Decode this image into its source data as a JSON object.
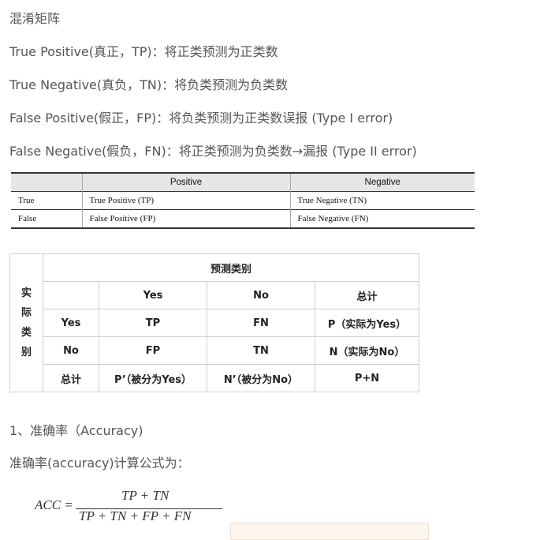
{
  "doc": {
    "heading": "混淆矩阵",
    "tp_def": "True Positive(真正，TP)：将正类预测为正类数",
    "tn_def": "True Negative(真负，TN)：将负类预测为负类数",
    "fp_def": "False Positive(假正，FP)：将负类预测为正类数误报 (Type I error)",
    "fn_def": "False Negative(假负，FN)：将正类预测为负类数→漏报 (Type II error)",
    "section1": "1、准确率（Accuracy)",
    "formula_intro": "准确率(accuracy)计算公式为："
  },
  "table1": {
    "headers": [
      "",
      "Positive",
      "Negative"
    ],
    "rows": [
      [
        "True",
        "True Positive (TP)",
        "True Negative (TN)"
      ],
      [
        "False",
        "False Positive (FP)",
        "False Negative (FN)"
      ]
    ]
  },
  "table2": {
    "predicted_header": "预测类别",
    "actual_chars": [
      "实",
      "际",
      "类",
      "别"
    ],
    "col_headers": [
      "Yes",
      "No",
      "总计"
    ],
    "rows": [
      [
        "Yes",
        "TP",
        "FN",
        "P（实际为Yes）"
      ],
      [
        "No",
        "FP",
        "TN",
        "N（实际为No）"
      ],
      [
        "总计",
        "P’（被分为Yes）",
        "N’（被分为No）",
        "P+N"
      ]
    ]
  },
  "formula": {
    "lhs": "ACC =",
    "numerator": "TP + TN",
    "denominator": "TP + TN + FP + FN"
  }
}
